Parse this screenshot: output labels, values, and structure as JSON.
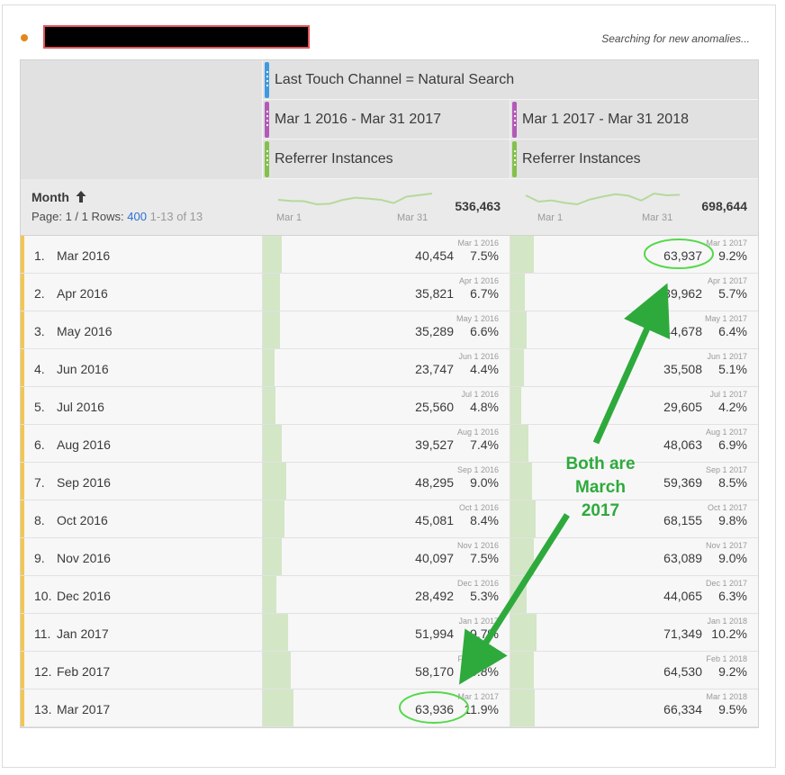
{
  "header": {
    "status_text": "Searching for new anomalies...",
    "status_dot_color": "#e68619"
  },
  "table": {
    "segment": {
      "label": "Last Touch Channel = Natural Search",
      "color": "#3c9be0"
    },
    "columns": [
      {
        "date_range": "Mar 1 2016 - Mar 31 2017",
        "metric": "Referrer Instances",
        "range_color": "#b359b8",
        "metric_color": "#83c14a",
        "total": "536,463",
        "spark_start": "Mar 1",
        "spark_end": "Mar 31"
      },
      {
        "date_range": "Mar 1 2017 - Mar 31 2018",
        "metric": "Referrer Instances",
        "range_color": "#b359b8",
        "metric_color": "#83c14a",
        "total": "698,644",
        "spark_start": "Mar 1",
        "spark_end": "Mar 31"
      }
    ],
    "dimension": {
      "title": "Month",
      "sort_icon": "arrow-up-icon",
      "page_label": "Page: 1 / 1",
      "rows_label": "Rows:",
      "rows_value": "400",
      "range_label": "1-13 of 13"
    },
    "rows": [
      {
        "index": "1.",
        "month": "Mar 2016",
        "c1": {
          "value": "40,454",
          "pct": "7.5%",
          "date": "Mar 1 2016",
          "share": 0.075
        },
        "c2": {
          "value": "63,937",
          "pct": "9.2%",
          "date": "Mar 1 2017",
          "share": 0.092
        }
      },
      {
        "index": "2.",
        "month": "Apr 2016",
        "c1": {
          "value": "35,821",
          "pct": "6.7%",
          "date": "Apr 1 2016",
          "share": 0.067
        },
        "c2": {
          "value": "39,962",
          "pct": "5.7%",
          "date": "Apr 1 2017",
          "share": 0.057
        }
      },
      {
        "index": "3.",
        "month": "May 2016",
        "c1": {
          "value": "35,289",
          "pct": "6.6%",
          "date": "May 1 2016",
          "share": 0.066
        },
        "c2": {
          "value": "44,678",
          "pct": "6.4%",
          "date": "May 1 2017",
          "share": 0.064
        }
      },
      {
        "index": "4.",
        "month": "Jun 2016",
        "c1": {
          "value": "23,747",
          "pct": "4.4%",
          "date": "Jun 1 2016",
          "share": 0.044
        },
        "c2": {
          "value": "35,508",
          "pct": "5.1%",
          "date": "Jun 1 2017",
          "share": 0.051
        }
      },
      {
        "index": "5.",
        "month": "Jul 2016",
        "c1": {
          "value": "25,560",
          "pct": "4.8%",
          "date": "Jul 1 2016",
          "share": 0.048
        },
        "c2": {
          "value": "29,605",
          "pct": "4.2%",
          "date": "Jul 1 2017",
          "share": 0.042
        }
      },
      {
        "index": "6.",
        "month": "Aug 2016",
        "c1": {
          "value": "39,527",
          "pct": "7.4%",
          "date": "Aug 1 2016",
          "share": 0.074
        },
        "c2": {
          "value": "48,063",
          "pct": "6.9%",
          "date": "Aug 1 2017",
          "share": 0.069
        }
      },
      {
        "index": "7.",
        "month": "Sep 2016",
        "c1": {
          "value": "48,295",
          "pct": "9.0%",
          "date": "Sep 1 2016",
          "share": 0.09
        },
        "c2": {
          "value": "59,369",
          "pct": "8.5%",
          "date": "Sep 1 2017",
          "share": 0.085
        }
      },
      {
        "index": "8.",
        "month": "Oct 2016",
        "c1": {
          "value": "45,081",
          "pct": "8.4%",
          "date": "Oct 1 2016",
          "share": 0.084
        },
        "c2": {
          "value": "68,155",
          "pct": "9.8%",
          "date": "Oct 1 2017",
          "share": 0.098
        }
      },
      {
        "index": "9.",
        "month": "Nov 2016",
        "c1": {
          "value": "40,097",
          "pct": "7.5%",
          "date": "Nov 1 2016",
          "share": 0.075
        },
        "c2": {
          "value": "63,089",
          "pct": "9.0%",
          "date": "Nov 1 2017",
          "share": 0.09
        }
      },
      {
        "index": "10.",
        "month": "Dec 2016",
        "c1": {
          "value": "28,492",
          "pct": "5.3%",
          "date": "Dec 1 2016",
          "share": 0.053
        },
        "c2": {
          "value": "44,065",
          "pct": "6.3%",
          "date": "Dec 1 2017",
          "share": 0.063
        }
      },
      {
        "index": "11.",
        "month": "Jan 2017",
        "c1": {
          "value": "51,994",
          "pct": "9.7%",
          "date": "Jan 1 2017",
          "share": 0.097
        },
        "c2": {
          "value": "71,349",
          "pct": "10.2%",
          "date": "Jan 1 2018",
          "share": 0.102
        }
      },
      {
        "index": "12.",
        "month": "Feb 2017",
        "c1": {
          "value": "58,170",
          "pct": "10.8%",
          "date": "Feb 1 2017",
          "share": 0.108
        },
        "c2": {
          "value": "64,530",
          "pct": "9.2%",
          "date": "Feb 1 2018",
          "share": 0.092
        }
      },
      {
        "index": "13.",
        "month": "Mar 2017",
        "c1": {
          "value": "63,936",
          "pct": "11.9%",
          "date": "Mar 1 2017",
          "share": 0.119
        },
        "c2": {
          "value": "66,334",
          "pct": "9.5%",
          "date": "Mar 1 2018",
          "share": 0.095
        }
      }
    ]
  },
  "annotation": {
    "lines": [
      "Both are",
      "March",
      "2017"
    ],
    "color": "#2eaa3c"
  }
}
